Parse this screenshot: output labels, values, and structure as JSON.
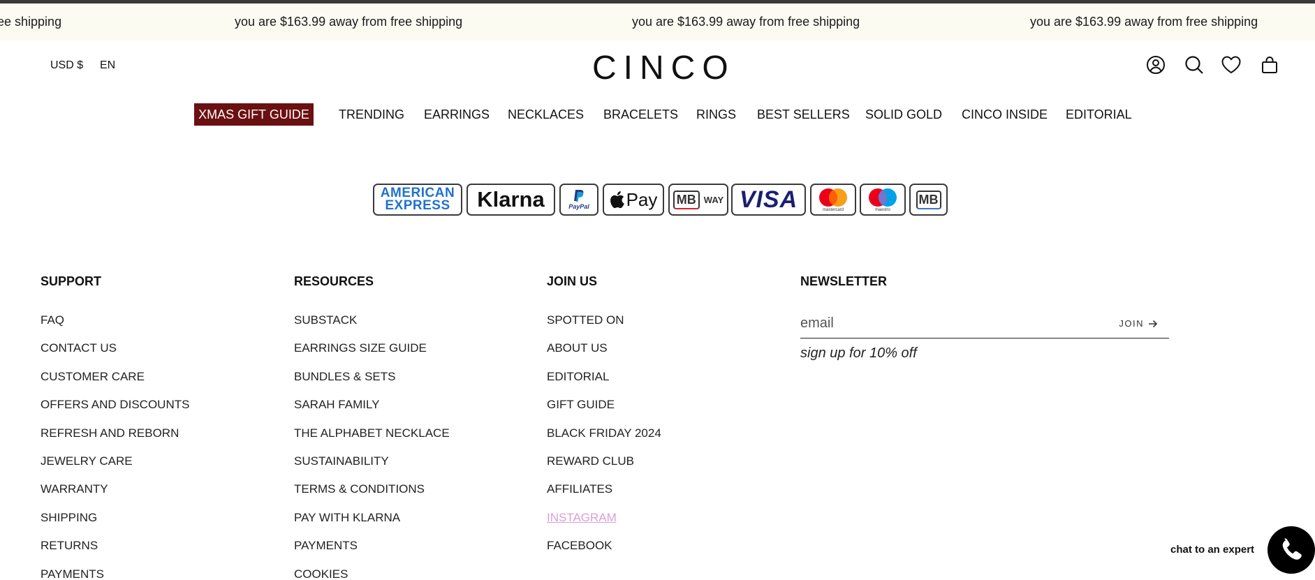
{
  "announcement": {
    "messages": [
      "ee shipping",
      "you are $163.99 away from free shipping",
      "you are $163.99 away from free shipping",
      "you are $163.99 away from free shipping"
    ]
  },
  "header": {
    "currency": "USD $",
    "language": "EN",
    "logo": "CINCO",
    "icons": [
      "account-icon",
      "search-icon",
      "wishlist-heart-icon",
      "cart-bag-icon"
    ]
  },
  "nav": {
    "highlight": "XMAS GIFT GUIDE",
    "highlight_color": "#6b1010",
    "items": [
      "TRENDING",
      "EARRINGS",
      "NECKLACES",
      "BRACELETS",
      "RINGS",
      "BEST SELLERS",
      "SOLID GOLD",
      "CINCO INSIDE",
      "EDITORIAL"
    ]
  },
  "payments": {
    "amex_line1": "AMERICAN",
    "amex_line2": "EXPRESS",
    "klarna": "Klarna",
    "paypal": "PayPal",
    "applepay": "Pay",
    "mbway_mb": "MB",
    "mbway_way": "WAY",
    "visa": "VISA",
    "mastercard": "mastercard",
    "maestro": "maestro",
    "multibanco": "MB"
  },
  "footer": {
    "support": {
      "heading": "SUPPORT",
      "links": [
        "FAQ",
        "CONTACT US",
        "CUSTOMER CARE",
        "OFFERS AND DISCOUNTS",
        "REFRESH AND REBORN",
        "JEWELRY CARE",
        "WARRANTY",
        "SHIPPING",
        "RETURNS",
        "PAYMENTS"
      ]
    },
    "resources": {
      "heading": "RESOURCES",
      "links": [
        "SUBSTACK",
        "EARRINGS SIZE GUIDE",
        "BUNDLES & SETS",
        "SARAH FAMILY",
        "THE ALPHABET NECKLACE",
        "SUSTAINABILITY",
        "TERMS & CONDITIONS",
        "PAY WITH KLARNA",
        "PAYMENTS",
        "COOKIES"
      ]
    },
    "join_us": {
      "heading": "JOIN US",
      "links": [
        "SPOTTED ON",
        "ABOUT US",
        "EDITORIAL",
        "GIFT GUIDE",
        "BLACK FRIDAY 2024",
        "REWARD CLUB",
        "AFFILIATES",
        "INSTAGRAM",
        "FACEBOOK"
      ],
      "accent_color": "#d8a0d6"
    },
    "newsletter": {
      "heading": "NEWSLETTER",
      "placeholder": "email",
      "join_label": "JOIN",
      "subtext": "sign up for 10% off"
    }
  },
  "chat": {
    "label": "chat to an expert"
  }
}
